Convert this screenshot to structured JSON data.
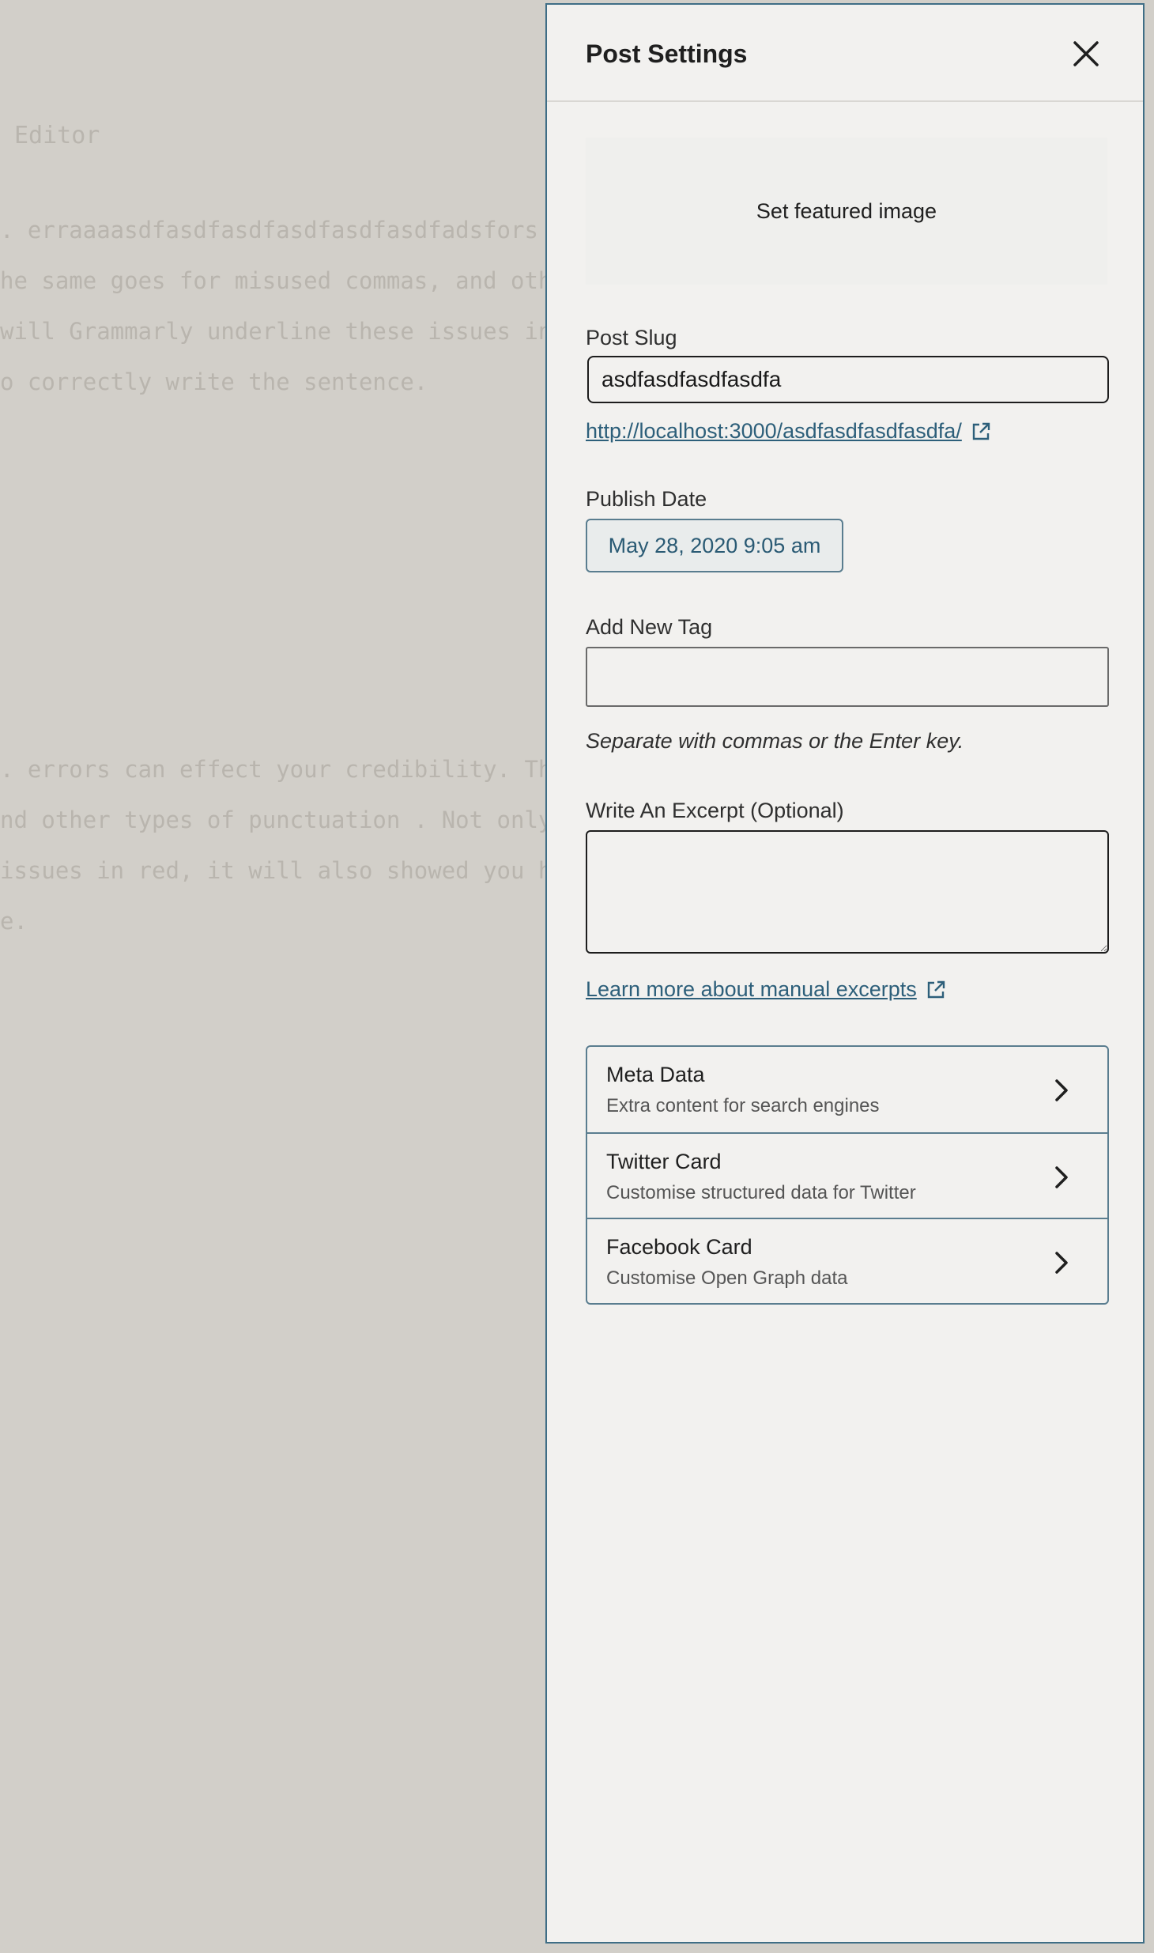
{
  "background_editor": {
    "title_fragment": "Editor",
    "lines_top": [
      ". erraaaasdfasdfasdfasdfasdfasdfadsfors c",
      "he same goes for misused commas, and othe",
      "will Grammarly underline these issues in",
      "o correctly write the sentence."
    ],
    "lines_bottom": [
      ". errors can effect your credibility. The",
      "nd other types of punctuation . Not only",
      "issues in red, it will also showed you ho",
      "e."
    ]
  },
  "panel": {
    "title": "Post Settings",
    "featured_image_label": "Set featured image",
    "post_slug": {
      "label": "Post Slug",
      "value": "asdfasdfasdfasdfa",
      "url": "http://localhost:3000/asdfasdfasdfasdfa/"
    },
    "publish_date": {
      "label": "Publish Date",
      "value": "May 28, 2020 9:05 am"
    },
    "tags": {
      "label": "Add New Tag",
      "value": "",
      "hint": "Separate with commas or the Enter key."
    },
    "excerpt": {
      "label": "Write An Excerpt (Optional)",
      "value": "",
      "learn_more": "Learn more about manual excerpts"
    },
    "sections": [
      {
        "title": "Meta Data",
        "subtitle": "Extra content for search engines"
      },
      {
        "title": "Twitter Card",
        "subtitle": "Customise structured data for Twitter"
      },
      {
        "title": "Facebook Card",
        "subtitle": "Customise Open Graph data"
      }
    ]
  },
  "colors": {
    "panel_border": "#3f6e86",
    "link": "#2d5f7a",
    "overlay_bg": "#d2cfc9"
  }
}
